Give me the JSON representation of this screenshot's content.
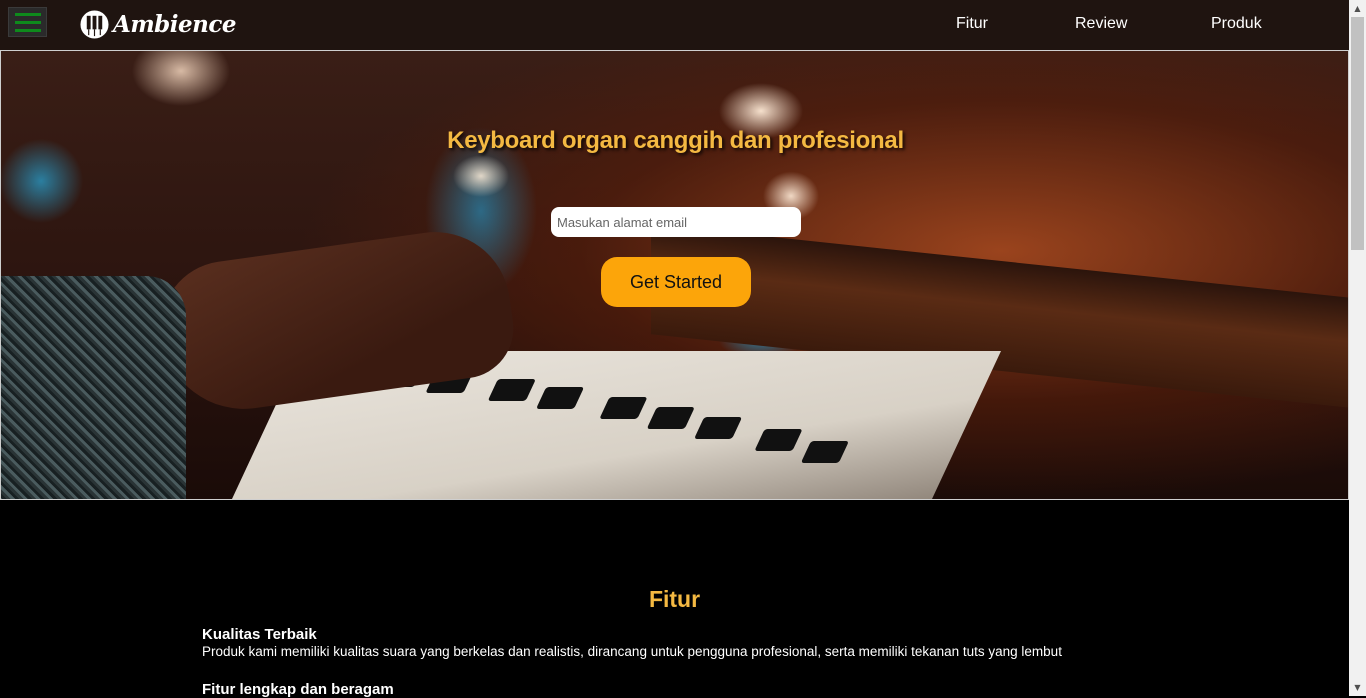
{
  "navbar": {
    "menu_icon": "hamburger-icon",
    "logo_icon": "piano-keys-icon",
    "brand": "Ambience",
    "links": [
      "Fitur",
      "Review",
      "Produk"
    ]
  },
  "hero": {
    "title": "Keyboard organ canggih dan profesional",
    "email_placeholder": "Masukan alamat email",
    "cta_label": "Get Started"
  },
  "features": {
    "title": "Fitur",
    "items": [
      {
        "heading": "Kualitas Terbaik",
        "description": "Produk kami memiliki kualitas suara yang berkelas dan realistis, dirancang untuk pengguna profesional, serta memiliki tekanan tuts yang lembut"
      },
      {
        "heading": "Fitur lengkap dan beragam",
        "description": ""
      }
    ]
  },
  "colors": {
    "navbar_bg": "#1f1410",
    "accent": "#f4b942",
    "cta_bg": "#fca50a",
    "menu_icon": "#0e8a1c"
  }
}
